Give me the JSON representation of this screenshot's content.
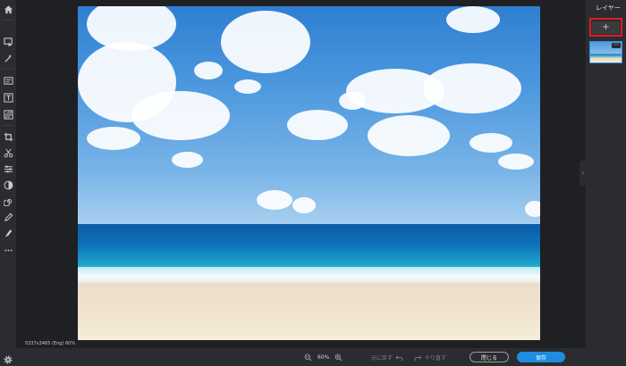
{
  "toolbar": {
    "tools": [
      "home-icon",
      "arrange-icon",
      "magic-icon",
      "adjust-image-icon",
      "text-icon",
      "texture-icon",
      "crop-icon",
      "cut-icon",
      "adjust-icon",
      "filter-icon",
      "spiral-icon",
      "draw-icon",
      "retouch-icon",
      "more-icon"
    ]
  },
  "canvas": {
    "dimensions_label": "5337x3465 (Eng) 60%"
  },
  "layers_panel": {
    "title": "レイヤー",
    "add_label": "+",
    "thumb_more": "···",
    "collapse_glyph": "›"
  },
  "bottom_bar": {
    "zoom_value": "60%",
    "undo_label": "元に戻す",
    "redo_label": "やり直す",
    "close_label": "閉じる",
    "save_label": "保存"
  },
  "colors": {
    "accent": "#1e8de0",
    "highlight_box": "#e11b22",
    "rail_bg": "#2b2c2f",
    "app_bg": "#1f2023"
  }
}
